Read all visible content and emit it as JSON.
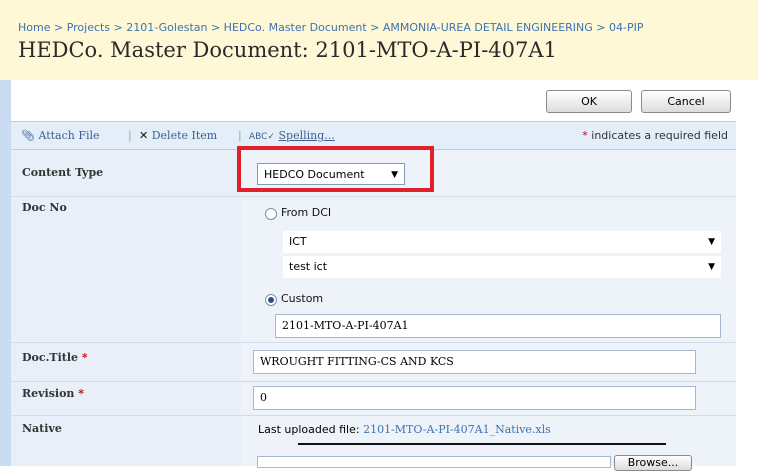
{
  "breadcrumb": "Home > Projects > 2101-Golestan > HEDCo. Master Document > AMMONIA-UREA DETAIL ENGINEERING > 04-PIP",
  "page_title": "HEDCo. Master Document: 2101-MTO-A-PI-407A1",
  "buttons": {
    "ok": "OK",
    "cancel": "Cancel",
    "browse": "Browse..."
  },
  "toolbar": {
    "attach_file": "Attach File",
    "delete_item": "Delete Item",
    "spelling": "Spelling...",
    "separator": "|",
    "required_star": "*",
    "required_note": "indicates a required field"
  },
  "form": {
    "content_type": {
      "label": "Content Type",
      "value": "HEDCO Document"
    },
    "doc_no": {
      "label": "Doc No",
      "from_dci_label": "From DCI",
      "dci_select_1": "ICT",
      "dci_select_2": "test ict",
      "custom_label": "Custom",
      "custom_value": "2101-MTO-A-PI-407A1",
      "selected": "custom"
    },
    "doc_title": {
      "label": "Doc.Title",
      "required": "*",
      "value": "WROUGHT FITTING-CS AND KCS"
    },
    "revision": {
      "label": "Revision",
      "required": "*",
      "value": "0"
    },
    "native": {
      "label": "Native",
      "last_uploaded_prefix": "Last uploaded file:",
      "file_name": "2101-MTO-A-PI-407A1_Native.xls"
    }
  },
  "colors": {
    "highlight": "#e0202a",
    "link": "#3d72b0",
    "header_bg": "#fff8d6"
  }
}
